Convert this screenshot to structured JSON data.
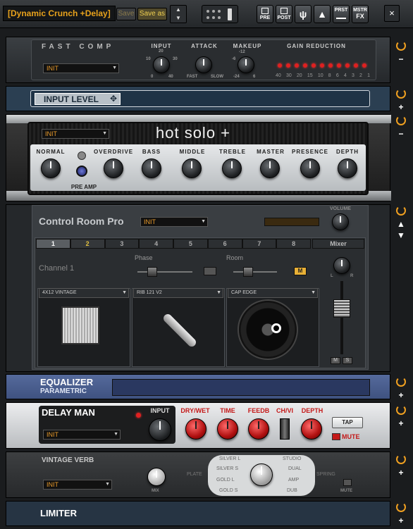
{
  "toolbar": {
    "preset_name": "[Dynamic Crunch +Delay]",
    "save_label": "Save",
    "save_as_label": "Save as",
    "pre_label": "PRE",
    "post_label": "POST",
    "prst_label": "PRST",
    "mstr_label": "MSTR",
    "fx_label": "FX",
    "close_label": "×"
  },
  "fast_comp": {
    "title": "FAST COMP",
    "preset": "INIT",
    "input_label": "INPUT",
    "attack_label": "ATTACK",
    "makeup_label": "MAKEUP",
    "gain_reduction_label": "GAIN REDUCTION",
    "input_ticks": [
      "10",
      "20",
      "30",
      "0",
      "40"
    ],
    "attack_ticks": [
      "FAST",
      "SLOW"
    ],
    "makeup_ticks": [
      "-6",
      "-12",
      "-24",
      "6"
    ],
    "gr_scale": [
      "40",
      "30",
      "20",
      "15",
      "10",
      "8",
      "6",
      "4",
      "3",
      "2",
      "1"
    ]
  },
  "input_level": {
    "title": "INPUT LEVEL"
  },
  "hot_solo": {
    "title": "hot solo +",
    "preset": "INIT",
    "knobs": [
      "NORMAL",
      "OVERDRIVE",
      "BASS",
      "MIDDLE",
      "TREBLE",
      "MASTER",
      "PRESENCE",
      "DEPTH"
    ],
    "pre_amp_label": "PRE AMP"
  },
  "control_room": {
    "title": "Control Room Pro",
    "preset": "INIT",
    "volume_label": "VOLUME",
    "channels": [
      "1",
      "2",
      "3",
      "4",
      "5",
      "6",
      "7",
      "8"
    ],
    "mixer_label": "Mixer",
    "channel_label": "Channel 1",
    "phase_label": "Phase",
    "room_label": "Room",
    "m_label": "M",
    "cab": "4X12 VINTAGE",
    "mic": "RIB 121 V2",
    "speaker": "CAP EDGE",
    "l_label": "L",
    "r_label": "R",
    "mute_btn": "M",
    "solo_btn": "S"
  },
  "equalizer": {
    "title": "EQUALIZER",
    "subtitle": "PARAMETRIC"
  },
  "delay_man": {
    "title": "DELAY MAN",
    "preset": "INIT",
    "input_label": "INPUT",
    "knobs": [
      "DRY/WET",
      "TIME",
      "FEEDB",
      "CH/VI",
      "DEPTH"
    ],
    "tap_label": "TAP",
    "mute_label": "MUTE"
  },
  "vintage_verb": {
    "title": "VINTAGE VERB",
    "preset": "INIT",
    "mix_label": "MIX",
    "plate_label": "PLATE",
    "spring_label": "SPRING",
    "mute_label": "MUTE",
    "types_left": [
      "SILVER L",
      "SILVER S",
      "GOLD L",
      "GOLD S"
    ],
    "types_right": [
      "STUDIO",
      "DUAL",
      "AMP",
      "DUB"
    ]
  },
  "limiter": {
    "title": "LIMITER"
  },
  "side_controls": {
    "plus": "+",
    "minus": "−"
  },
  "colors": {
    "accent": "#e89a2a",
    "led": "#e02020",
    "eq_blue": "#4a5f90"
  }
}
